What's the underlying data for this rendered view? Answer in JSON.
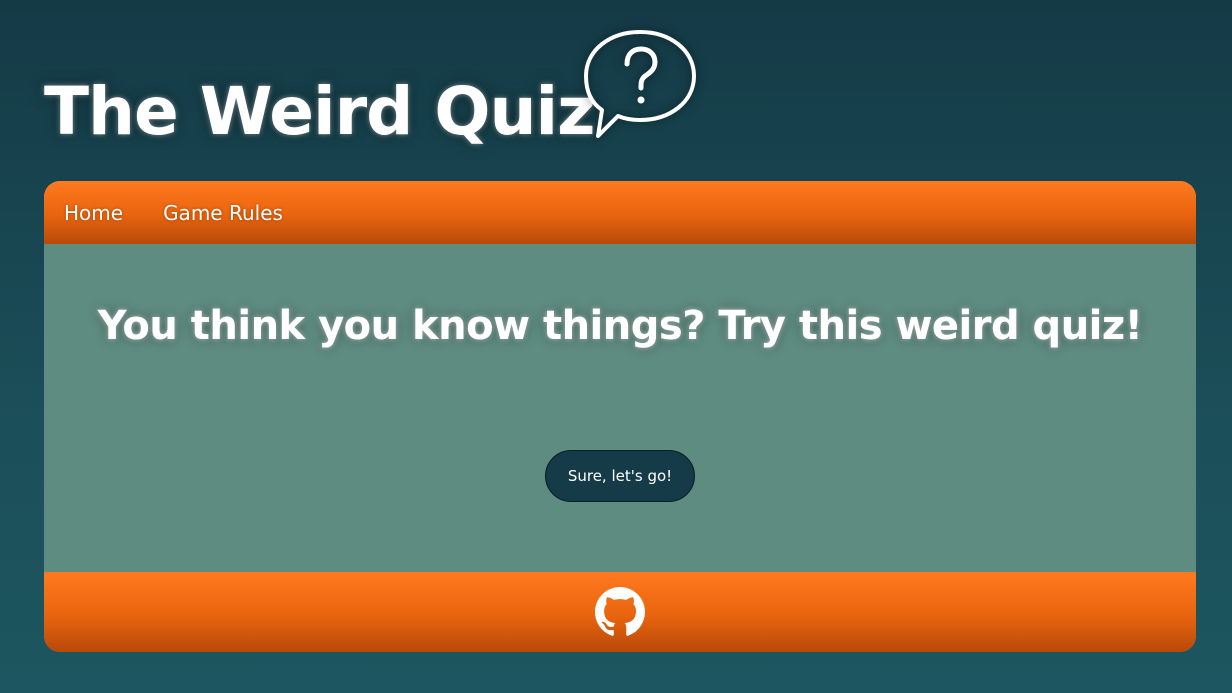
{
  "header": {
    "title": "The Weird Quiz",
    "icon": "question-speech-bubble-icon"
  },
  "nav": {
    "items": [
      {
        "label": "Home"
      },
      {
        "label": "Game Rules"
      }
    ]
  },
  "main": {
    "heading": "You think you know things? Try this weird quiz!",
    "start_button": "Sure, let's go!"
  },
  "footer": {
    "icon": "github-icon"
  },
  "colors": {
    "background": "#1b4f59",
    "accent_orange": "#f26a12",
    "panel_green": "#5f8c80",
    "button_dark": "#153b48",
    "text": "#ffffff"
  }
}
